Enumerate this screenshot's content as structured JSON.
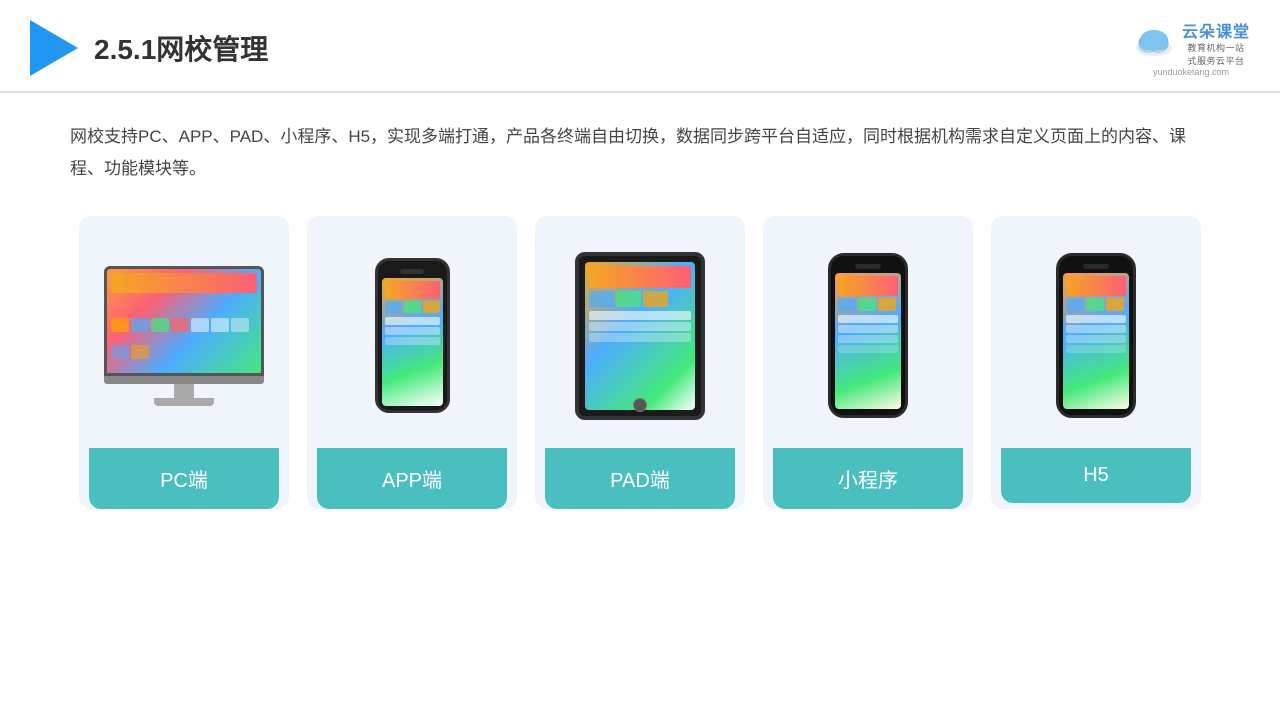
{
  "header": {
    "title": "2.5.1网校管理",
    "brand": {
      "name": "云朵课堂",
      "url": "yunduoketang.com",
      "tagline": "教育机构一站\n式服务云平台"
    }
  },
  "description": "网校支持PC、APP、PAD、小程序、H5，实现多端打通，产品各终端自由切换，数据同步跨平台自适应，同时根据机构需求自定义页面上的内容、课程、功能模块等。",
  "cards": [
    {
      "id": "pc",
      "label": "PC端",
      "type": "pc"
    },
    {
      "id": "app",
      "label": "APP端",
      "type": "phone"
    },
    {
      "id": "pad",
      "label": "PAD端",
      "type": "tablet"
    },
    {
      "id": "miniapp",
      "label": "小程序",
      "type": "miniphone"
    },
    {
      "id": "h5",
      "label": "H5",
      "type": "miniphone2"
    }
  ],
  "colors": {
    "accent": "#4bbfbf",
    "blue": "#2196F3",
    "title": "#333333",
    "text": "#444444"
  }
}
